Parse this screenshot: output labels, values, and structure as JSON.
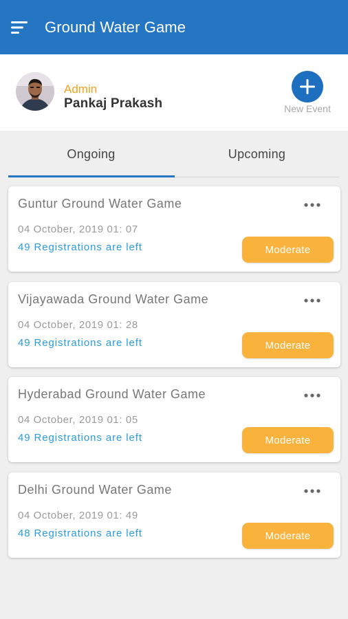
{
  "appbar": {
    "title": "Ground Water Game",
    "menu_icon": "sort-menu-icon",
    "color": "#2476c3"
  },
  "profile": {
    "role": "Admin",
    "name": "Pankaj Prakash",
    "new_event_label": "New Event",
    "accent": "#f5a11c"
  },
  "tabs": [
    {
      "label": "Ongoing",
      "selected": true
    },
    {
      "label": "Upcoming",
      "selected": false
    }
  ],
  "events": [
    {
      "title": "Guntur Ground Water Game",
      "date": "04 October, 2019 01: 07",
      "registrations": "49 Registrations are left",
      "action": "Moderate"
    },
    {
      "title": "Vijayawada Ground Water Game",
      "date": "04 October, 2019 01: 28",
      "registrations": "49 Registrations are left",
      "action": "Moderate"
    },
    {
      "title": "Hyderabad Ground Water Game",
      "date": "04 October, 2019 01: 05",
      "registrations": "49 Registrations are left",
      "action": "Moderate"
    },
    {
      "title": "Delhi Ground Water Game",
      "date": "04 October, 2019 01: 49",
      "registrations": "48 Registrations are left",
      "action": "Moderate"
    }
  ]
}
